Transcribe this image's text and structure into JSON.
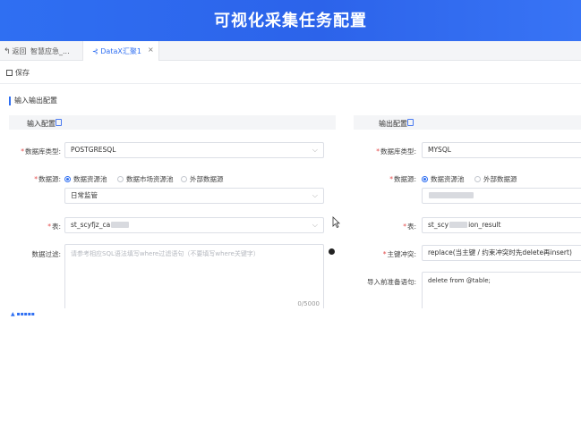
{
  "banner": {
    "title": "可视化采集任务配置"
  },
  "tabs": {
    "back_label": "返回",
    "items": [
      {
        "label": "智慧应急_..."
      },
      {
        "label": "DataX汇聚1",
        "close": "×"
      }
    ]
  },
  "toolbar": {
    "save_label": "保存"
  },
  "section": {
    "title": "输入输出配置"
  },
  "input_panel": {
    "title": "输入配置",
    "db_type_label": "数据库类型",
    "db_type_value": "POSTGRESQL",
    "source_label": "数据源",
    "source_options": [
      "数据资源池",
      "数据市场资源池",
      "外部数据源"
    ],
    "source_selected": 0,
    "source_value": "日常监管",
    "table_label": "表",
    "table_prefix": "st_scyfjz_ca",
    "filter_label": "数据过滤",
    "filter_placeholder": "请参考相应SQL语法填写where过滤语句（不要填写where关键字）",
    "filter_counter": "0/5000"
  },
  "output_panel": {
    "title": "输出配置",
    "db_type_label": "数据库类型",
    "db_type_value": "MYSQL",
    "source_label": "数据源",
    "source_options": [
      "数据资源池",
      "外部数据源"
    ],
    "source_selected": 0,
    "table_label": "表",
    "table_prefix": "st_scy",
    "table_suffix": "ion_result",
    "conflict_label": "主键冲突",
    "conflict_value": "replace(当主键 / 约束冲突时先delete再insert)",
    "pre_sql_label": "导入前准备语句",
    "pre_sql_value": "delete from @table;"
  },
  "colors": {
    "accent": "#2f6ff2",
    "required": "#e34b4b"
  }
}
